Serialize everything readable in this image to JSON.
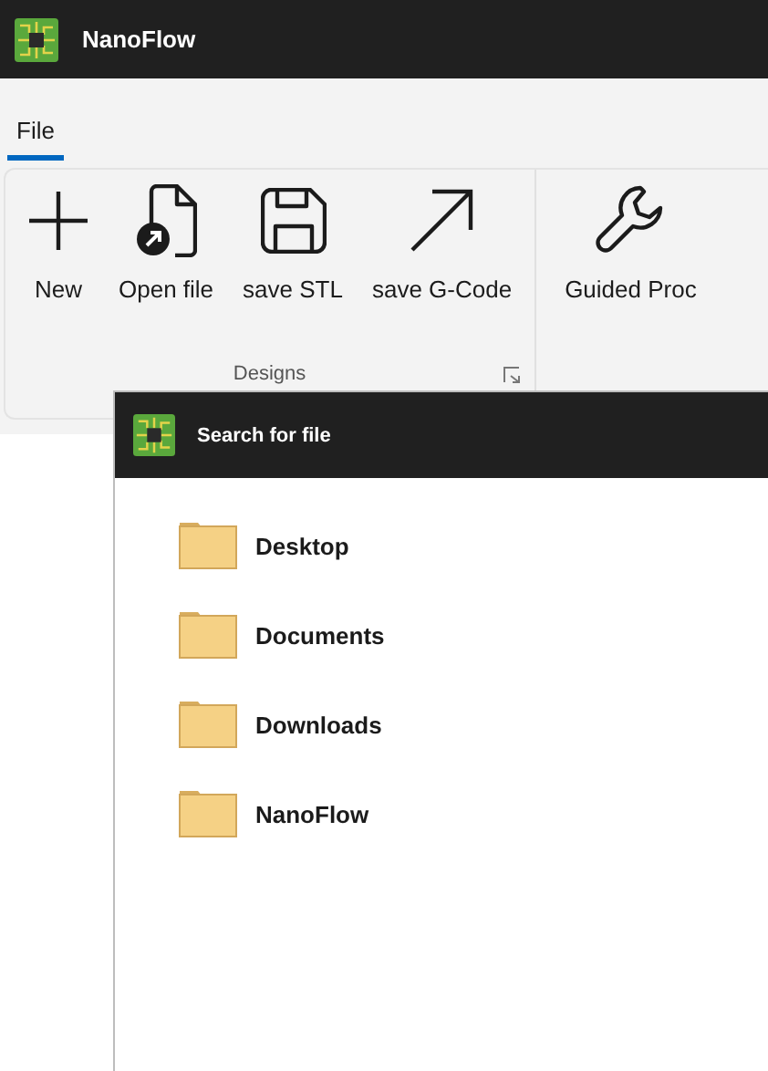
{
  "window": {
    "title": "NanoFlow"
  },
  "menu_tabs": [
    {
      "label": "File",
      "selected": true
    }
  ],
  "ribbon": {
    "groups": [
      {
        "label": "Designs",
        "buttons": [
          {
            "label": "New",
            "kind": "plus"
          },
          {
            "label": "Open file",
            "kind": "open"
          },
          {
            "label": "save STL",
            "kind": "floppy"
          },
          {
            "label": "save G-Code",
            "kind": "arrow"
          }
        ]
      },
      {
        "buttons": [
          {
            "label": "Guided Proc",
            "kind": "wrench"
          }
        ]
      }
    ]
  },
  "dialog": {
    "title": "Search for file",
    "folders": [
      {
        "name": "Desktop"
      },
      {
        "name": "Documents"
      },
      {
        "name": "Downloads"
      },
      {
        "name": "NanoFlow"
      }
    ]
  }
}
